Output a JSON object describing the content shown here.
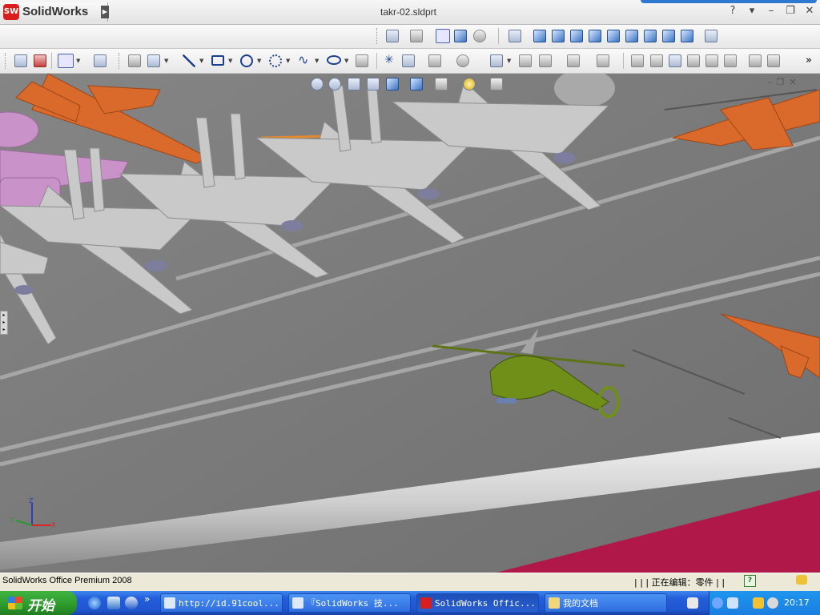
{
  "app": {
    "brand": "SolidWorks",
    "brand_logo_text": "SW",
    "document_title": "takr-02.sldprt"
  },
  "window_controls": [
    "?",
    "▾",
    "–",
    "❐",
    "✕"
  ],
  "toolbar_icons": {
    "row1": [
      "sketch-icon",
      "rebuild-icon",
      "view-display-icon",
      "shaded-icon",
      "hidden-lines-icon",
      "front-view-icon",
      "back-view-icon",
      "left-view-icon",
      "right-view-icon",
      "top-view-icon",
      "bottom-view-icon",
      "isometric-icon",
      "trimetric-icon",
      "dimetric-icon",
      "normal-to-icon"
    ],
    "row2": [
      "select-icon",
      "grid-icon",
      "line-icon",
      "rectangle-icon",
      "circle-icon",
      "arc-icon",
      "spline-icon",
      "ellipse-icon",
      "fillet-icon",
      "point-icon",
      "construction-icon",
      "trim-icon",
      "offset-icon",
      "mirror-icon",
      "pattern-icon",
      "move-icon",
      "feature-icon"
    ]
  },
  "status": {
    "product": "SolidWorks Office Premium 2008",
    "separator": "| | |",
    "editing": "正在编辑：零件",
    "separator2": "| |"
  },
  "taskbar": {
    "start_label": "开始",
    "tasks": [
      {
        "label": "http://id.91cool...",
        "active": false
      },
      {
        "label": "『SolidWorks 技...",
        "active": false
      },
      {
        "label": "SolidWorks Offic...",
        "active": true
      },
      {
        "label": "我的文档",
        "active": false
      }
    ],
    "clock": "20:17",
    "more": "»"
  },
  "axis_labels": {
    "x": "X",
    "y": "Y",
    "z": "Z"
  },
  "colors": {
    "taskbar_blue": "#245edb",
    "start_green": "#2c9a2c",
    "deck_gray": "#7a7a7a",
    "fighter_gray": "#c9c9c9",
    "fighter_orange": "#d96a2c",
    "helicopter_green": "#6f8f18",
    "hull_red": "#b0184a"
  }
}
